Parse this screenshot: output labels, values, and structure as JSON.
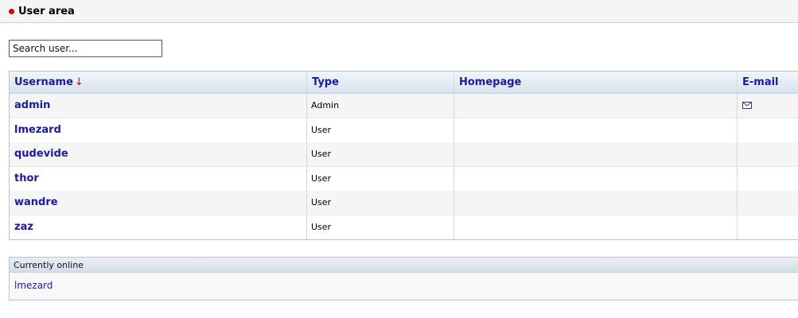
{
  "header": {
    "title": "User area"
  },
  "search": {
    "placeholder": "Search user..."
  },
  "table": {
    "columns": {
      "username": "Username",
      "username_sort_indicator": "↓",
      "type": "Type",
      "homepage": "Homepage",
      "email": "E-mail"
    },
    "rows": [
      {
        "username": "admin",
        "type": "Admin",
        "homepage": "",
        "has_email": true
      },
      {
        "username": "lmezard",
        "type": "User",
        "homepage": "",
        "has_email": false
      },
      {
        "username": "qudevide",
        "type": "User",
        "homepage": "",
        "has_email": false
      },
      {
        "username": "thor",
        "type": "User",
        "homepage": "",
        "has_email": false
      },
      {
        "username": "wandre",
        "type": "User",
        "homepage": "",
        "has_email": false
      },
      {
        "username": "zaz",
        "type": "User",
        "homepage": "",
        "has_email": false
      }
    ]
  },
  "online": {
    "title": "Currently online",
    "users": [
      "lmezard"
    ]
  },
  "colors": {
    "accent_dot": "#e00000",
    "link": "#1a1aa6",
    "header_gradient_end": "#d8e2ec"
  }
}
